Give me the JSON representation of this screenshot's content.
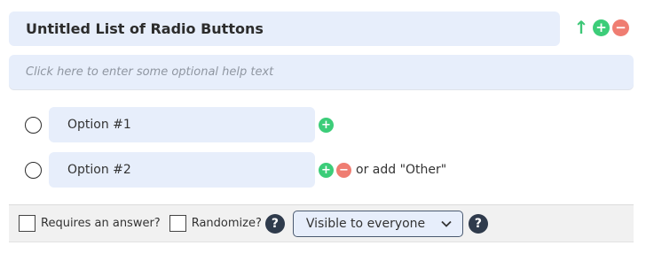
{
  "question": {
    "title": "Untitled List of Radio Buttons",
    "help_placeholder": "Click here to enter some optional help text"
  },
  "controls": {
    "move_up_icon": "arrow-up-icon",
    "add_icon": "plus-icon",
    "remove_icon": "minus-icon",
    "plus_glyph": "+",
    "minus_glyph": "−",
    "arrow_glyph": "↑"
  },
  "options": [
    {
      "label": "Option #1"
    },
    {
      "label": "Option #2"
    }
  ],
  "add_other_text": "or add \"Other\"",
  "footer": {
    "requires_answer_label": "Requires an answer?",
    "randomize_label": "Randomize?",
    "help_glyph": "?",
    "visibility_selected": "Visible to everyone"
  },
  "colors": {
    "field_bg": "#e7eefb",
    "add_green": "#3ccd79",
    "remove_red": "#ef7d72",
    "help_dark": "#2f3b4c"
  }
}
